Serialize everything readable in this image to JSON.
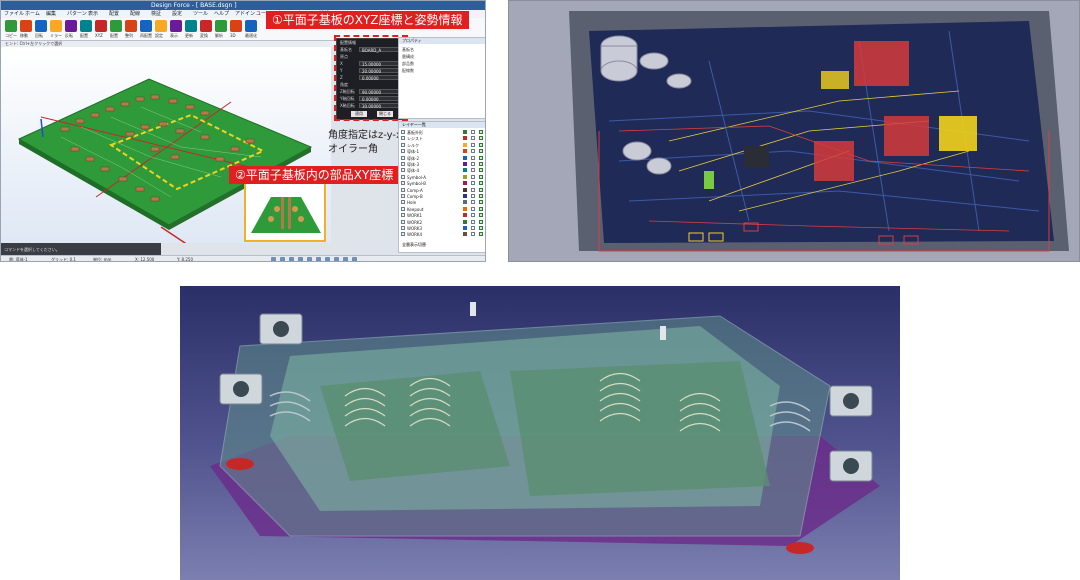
{
  "app": {
    "title": "Design Force - [ BASE.dsgn ]",
    "menu": [
      "ファイル",
      "ホーム",
      "編集",
      "パターン",
      "表示",
      "配置",
      "配線",
      "検証",
      "設定",
      "ツール",
      "ヘルプ",
      "アドイン",
      "ユーティリティ",
      "ウィンドウ",
      "3D",
      "解析"
    ],
    "ribbon": [
      "コピー",
      "移動",
      "回転",
      "ミラー",
      "反転",
      "配置",
      "XYZ",
      "配置",
      "整列",
      "再配置",
      "設定",
      "表示",
      "更新",
      "変換",
      "解析",
      "3D",
      "最適化"
    ],
    "command_hint": "ヒント: Ctrl+左クリックで選択",
    "annotation_1": "①平面子基板のXYZ座標と姿勢情報",
    "annotation_2": "②平面子基板内の部品XY座標",
    "note_line1": "角度指定はz-y-x",
    "note_line2": "オイラー角",
    "coord_dialog": {
      "title": "配置情報",
      "rows": [
        {
          "label": "基板名",
          "value": "BOARD_A"
        },
        {
          "label": "原点",
          "value": ""
        },
        {
          "label": "X",
          "value": "15.00000"
        },
        {
          "label": "Y",
          "value": "20.00000"
        },
        {
          "label": "Z",
          "value": "0.00000"
        },
        {
          "label": "角度",
          "value": ""
        },
        {
          "label": "Z軸回転",
          "value": "90.00000"
        },
        {
          "label": "Y軸回転",
          "value": "0.00000"
        },
        {
          "label": "X軸回転",
          "value": "30.00000"
        }
      ],
      "ok": "適用",
      "close": "閉じる"
    },
    "props_panel": {
      "title": "プロパティ",
      "items": [
        "基板名",
        "層構成",
        "部品数",
        "配線数"
      ]
    },
    "layer_panel": {
      "title": "レイヤー一覧",
      "layers": [
        {
          "name": "基板外形",
          "color": "#2e7d32"
        },
        {
          "name": "レジスト",
          "color": "#c62828"
        },
        {
          "name": "シルク",
          "color": "#f9a825"
        },
        {
          "name": "導体-1",
          "color": "#d84315"
        },
        {
          "name": "導体-2",
          "color": "#1565c0"
        },
        {
          "name": "導体-3",
          "color": "#6a1b9a"
        },
        {
          "name": "導体-4",
          "color": "#00838f"
        },
        {
          "name": "Symbol-A",
          "color": "#9e9d24"
        },
        {
          "name": "Symbol-B",
          "color": "#ad1457"
        },
        {
          "name": "Comp-A",
          "color": "#4e342e"
        },
        {
          "name": "Comp-B",
          "color": "#283593"
        },
        {
          "name": "Hole",
          "color": "#546e7a"
        },
        {
          "name": "Keepout",
          "color": "#ef6c00"
        },
        {
          "name": "WORK1",
          "color": "#c62828"
        },
        {
          "name": "WORK2",
          "color": "#2e7d32"
        },
        {
          "name": "WORK3",
          "color": "#1565c0"
        },
        {
          "name": "WORK4",
          "color": "#6d4c41"
        }
      ],
      "footer": "全層表示切替"
    },
    "message": "コマンドを選択してください。",
    "status": [
      "層: 導体-1",
      "グリッド: 0.1",
      "単位: mm",
      "X: 12.500",
      "Y: 8.250"
    ]
  },
  "colors": {
    "annotation_red": "#e02020",
    "board_green": "#2f9a3a",
    "highlight_yellow": "#f2d21b"
  }
}
